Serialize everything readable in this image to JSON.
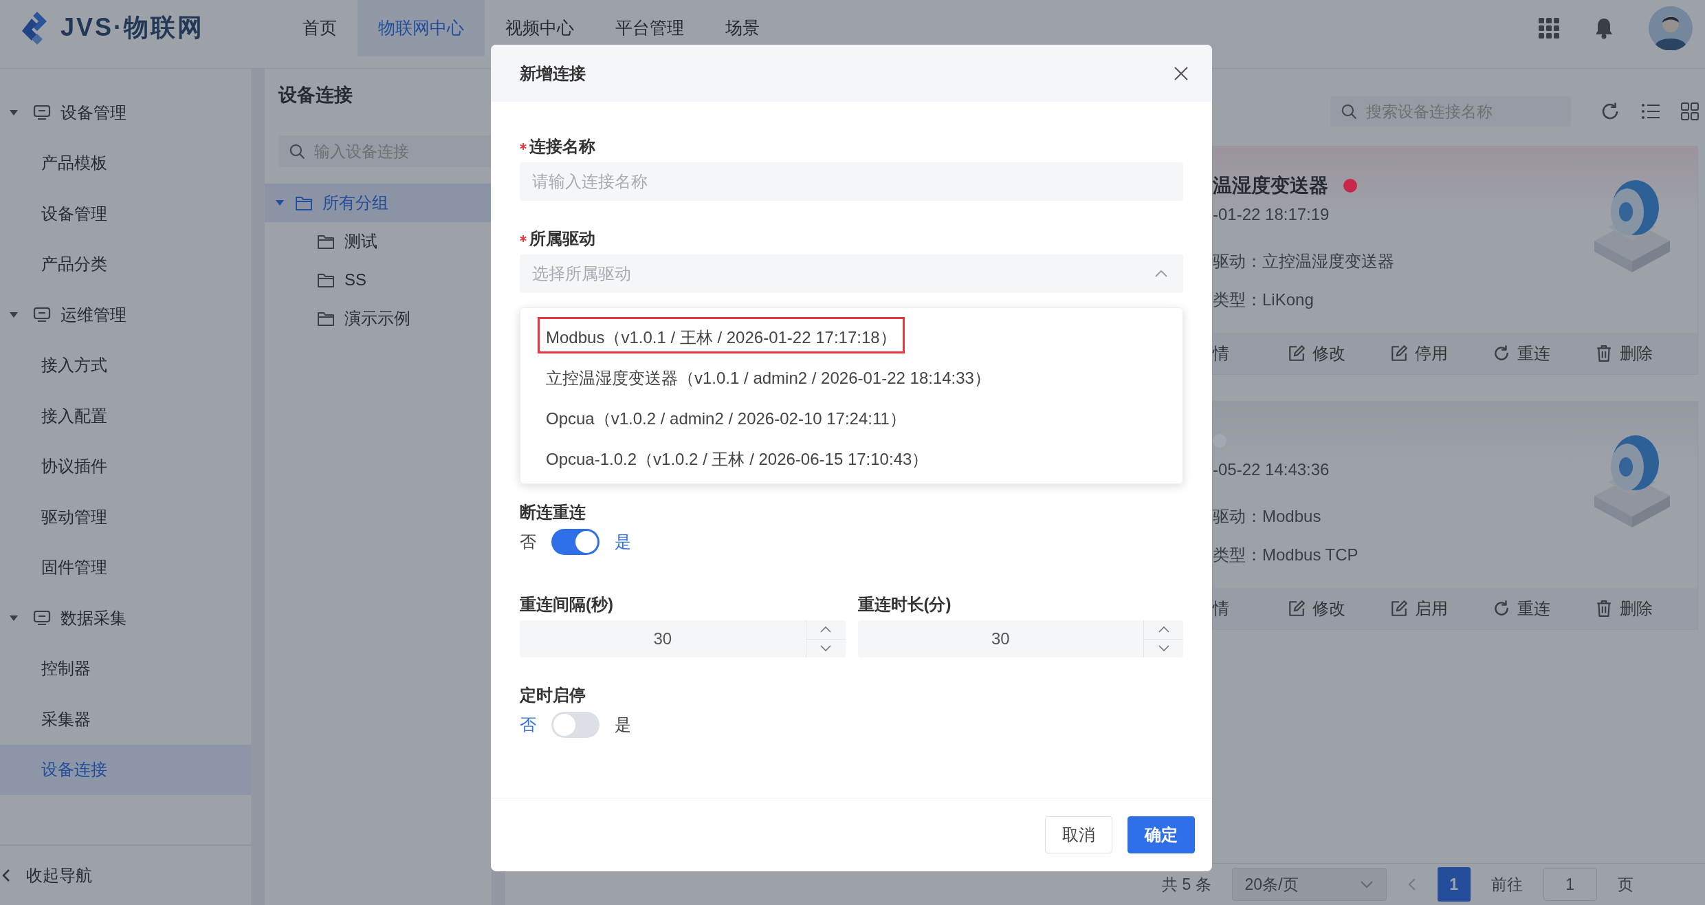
{
  "top_bar": {
    "logo": "JVS·物联网",
    "nav": [
      {
        "label": "首页",
        "selected": false
      },
      {
        "label": "物联网中心",
        "selected": true
      },
      {
        "label": "视频中心",
        "selected": false
      },
      {
        "label": "平台管理",
        "selected": false
      },
      {
        "label": "场景",
        "selected": false
      }
    ]
  },
  "sidebar": {
    "groups": [
      {
        "label": "设备管理",
        "expanded": true,
        "children": [
          {
            "label": "产品模板",
            "selected": false
          },
          {
            "label": "设备管理",
            "selected": false
          },
          {
            "label": "产品分类",
            "selected": false
          }
        ]
      },
      {
        "label": "运维管理",
        "expanded": true,
        "children": [
          {
            "label": "接入方式",
            "selected": false
          },
          {
            "label": "接入配置",
            "selected": false
          },
          {
            "label": "协议插件",
            "selected": false
          },
          {
            "label": "驱动管理",
            "selected": false
          },
          {
            "label": "固件管理",
            "selected": false
          }
        ]
      },
      {
        "label": "数据采集",
        "expanded": true,
        "children": [
          {
            "label": "控制器",
            "selected": false
          },
          {
            "label": "采集器",
            "selected": false
          },
          {
            "label": "设备连接",
            "selected": true
          }
        ]
      }
    ],
    "collapse": "收起导航"
  },
  "tree_panel": {
    "title": "设备连接",
    "search": {
      "placeholder": "输入设备连接"
    },
    "tree": [
      {
        "label": "所有分组",
        "expanded": true,
        "selected": true,
        "children": [
          {
            "label": "测试",
            "selected": false
          },
          {
            "label": "SS",
            "selected": false
          },
          {
            "label": "演示示例",
            "selected": false
          }
        ]
      }
    ]
  },
  "cards_panel": {
    "search": {
      "placeholder": "搜索设备连接名称"
    },
    "cards": [
      {
        "title": "温湿度变送器",
        "color": "#c8294b",
        "time": "-01-22 18:17:19",
        "fields": [
          "驱动：立控温湿度变送器",
          "类型：LiKong"
        ],
        "actions": [
          {
            "label": "情",
            "kind": "none"
          },
          {
            "label": "修改",
            "kind": "edit"
          },
          {
            "label": "停用",
            "kind": "edit"
          },
          {
            "label": "重连",
            "kind": "refresh"
          },
          {
            "label": "删除",
            "kind": "delete"
          }
        ]
      },
      {
        "color": "#a4a8b0",
        "time": "-05-22 14:43:36",
        "fields": [
          "驱动：Modbus",
          "类型：Modbus TCP"
        ],
        "actions": [
          {
            "label": "情",
            "kind": "none"
          },
          {
            "label": "修改",
            "kind": "edit"
          },
          {
            "label": "启用",
            "kind": "edit"
          },
          {
            "label": "重连",
            "kind": "refresh"
          },
          {
            "label": "删除",
            "kind": "delete"
          }
        ]
      }
    ],
    "pagination": {
      "total": "共 5 条",
      "page_size": "20条/页",
      "pages": [
        {
          "label": "1",
          "selected": true
        }
      ],
      "goto": "前往",
      "goto_value": "1",
      "suffix": "页"
    }
  },
  "dialog": {
    "title": "新增连接",
    "fields": [
      {
        "kind": "text",
        "label": "连接名称",
        "required": true,
        "placeholder": "请输入连接名称"
      },
      {
        "kind": "select",
        "label": "所属驱动",
        "required": true,
        "placeholder": "选择所属驱动",
        "expanded": true,
        "options": [
          {
            "label": "Modbus（v1.0.1 / 王林 / 2026-01-22 17:17:18）",
            "highlighted": true
          },
          {
            "label": "立控温湿度变送器（v1.0.1 / admin2 / 2026-01-22 18:14:33）",
            "highlighted": false
          },
          {
            "label": "Opcua（v1.0.2 / admin2 / 2026-02-10 17:24:11）",
            "highlighted": false
          },
          {
            "label": "Opcua-1.0.2（v1.0.2 / 王林 / 2026-06-15 17:10:43）",
            "highlighted": false
          }
        ]
      },
      {
        "kind": "switch",
        "label": "断连重连",
        "off_label": "否",
        "on_label": "是",
        "on": true
      },
      {
        "kind": "number_pair",
        "items": [
          {
            "label": "重连间隔(秒)",
            "value": "30"
          },
          {
            "label": "重连时长(分)",
            "value": "30"
          }
        ]
      },
      {
        "kind": "switch",
        "label": "定时启停",
        "off_label": "否",
        "on_label": "是",
        "on": false
      }
    ],
    "buttons": [
      {
        "label": "取消",
        "kind": "default"
      },
      {
        "label": "确定",
        "kind": "primary"
      }
    ]
  }
}
